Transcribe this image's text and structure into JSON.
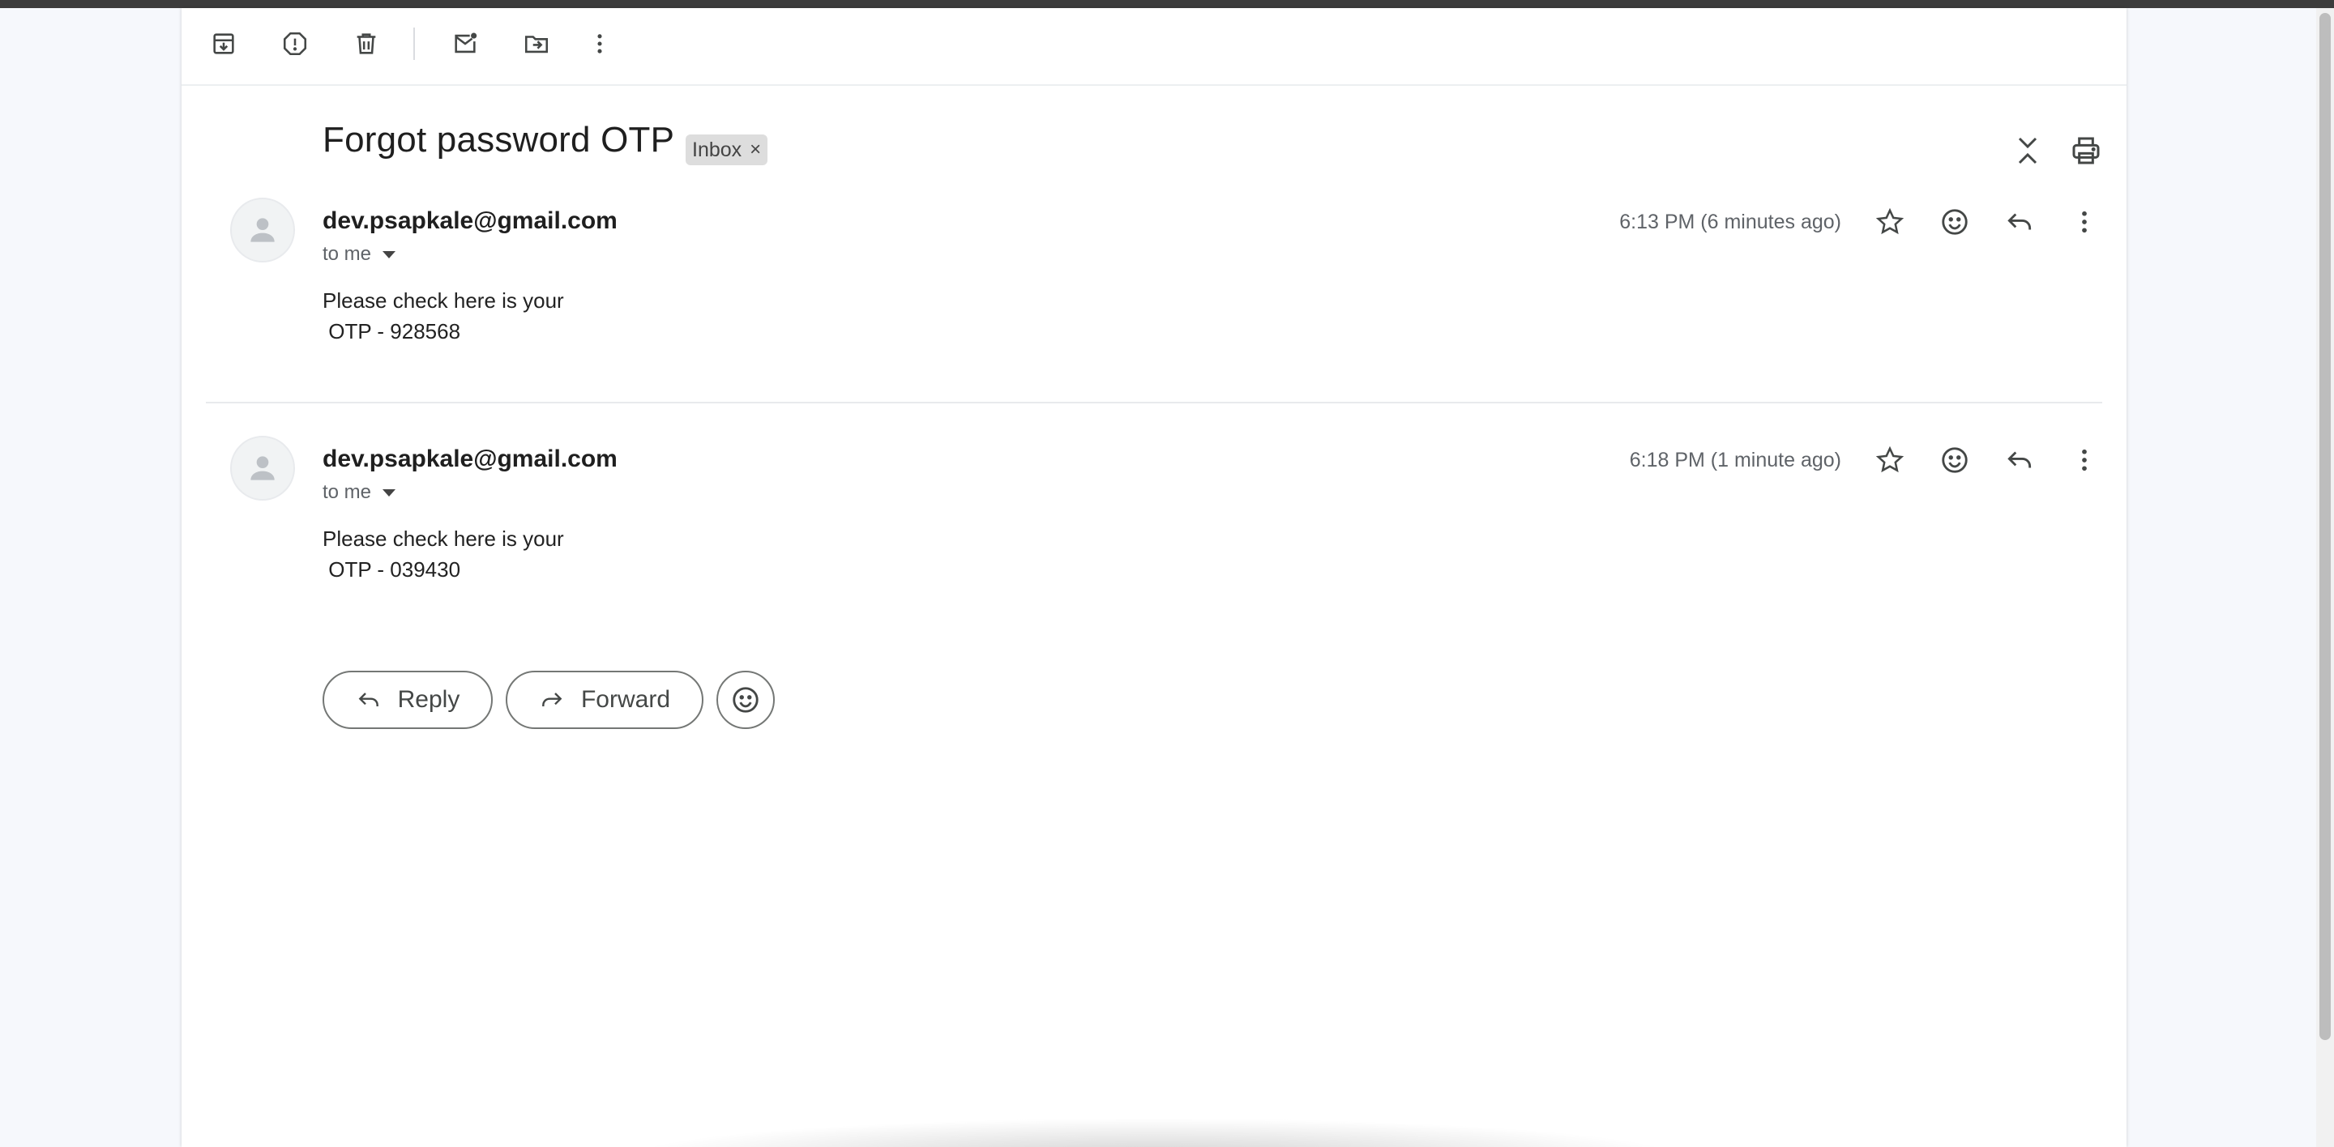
{
  "toolbar": {
    "icons": [
      "archive-icon",
      "report-spam-icon",
      "delete-icon",
      "mark-unread-icon",
      "move-to-icon",
      "more-vert-icon"
    ]
  },
  "thread": {
    "subject": "Forgot password OTP",
    "label": "Inbox",
    "label_remove": "×"
  },
  "messages": [
    {
      "sender": "dev.psapkale@gmail.com",
      "recipient": "to me",
      "time": "6:13 PM (6 minutes ago)",
      "body_line1": "Please check here is your",
      "body_line2": " OTP - 928568"
    },
    {
      "sender": "dev.psapkale@gmail.com",
      "recipient": "to me",
      "time": "6:18 PM (1 minute ago)",
      "body_line1": "Please check here is your",
      "body_line2": " OTP - 039430"
    }
  ],
  "actions": {
    "reply_label": "Reply",
    "forward_label": "Forward"
  },
  "colors": {
    "page_bg": "#f6f8fc",
    "panel_bg": "#ffffff",
    "icon": "#444746",
    "chip_bg": "#dddddd"
  }
}
